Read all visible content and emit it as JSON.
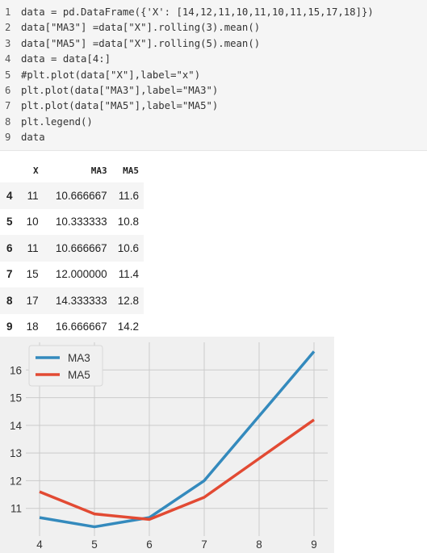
{
  "code": {
    "lines": [
      {
        "n": "1",
        "text": "data = pd.DataFrame({'X': [14,12,11,10,11,10,11,15,17,18]})"
      },
      {
        "n": "2",
        "text": "data[\"MA3\"] =data[\"X\"].rolling(3).mean()"
      },
      {
        "n": "3",
        "text": "data[\"MA5\"] =data[\"X\"].rolling(5).mean()"
      },
      {
        "n": "4",
        "text": "data = data[4:]"
      },
      {
        "n": "5",
        "text": "#plt.plot(data[\"X\"],label=\"x\")"
      },
      {
        "n": "6",
        "text": "plt.plot(data[\"MA3\"],label=\"MA3\")"
      },
      {
        "n": "7",
        "text": "plt.plot(data[\"MA5\"],label=\"MA5\")"
      },
      {
        "n": "8",
        "text": "plt.legend()"
      },
      {
        "n": "9",
        "text": "data"
      }
    ]
  },
  "table": {
    "columns": [
      "X",
      "MA3",
      "MA5"
    ],
    "rows": [
      {
        "idx": "4",
        "X": "11",
        "MA3": "10.666667",
        "MA5": "11.6"
      },
      {
        "idx": "5",
        "X": "10",
        "MA3": "10.333333",
        "MA5": "10.8"
      },
      {
        "idx": "6",
        "X": "11",
        "MA3": "10.666667",
        "MA5": "10.6"
      },
      {
        "idx": "7",
        "X": "15",
        "MA3": "12.000000",
        "MA5": "11.4"
      },
      {
        "idx": "8",
        "X": "17",
        "MA3": "14.333333",
        "MA5": "12.8"
      },
      {
        "idx": "9",
        "X": "18",
        "MA3": "16.666667",
        "MA5": "14.2"
      }
    ]
  },
  "chart_data": {
    "type": "line",
    "x": [
      4,
      5,
      6,
      7,
      8,
      9
    ],
    "series": [
      {
        "name": "MA3",
        "color": "#348abd",
        "values": [
          10.666667,
          10.333333,
          10.666667,
          12.0,
          14.333333,
          16.666667
        ]
      },
      {
        "name": "MA5",
        "color": "#e24a33",
        "values": [
          11.6,
          10.8,
          10.6,
          11.4,
          12.8,
          14.2
        ]
      }
    ],
    "xticks": [
      "4",
      "5",
      "6",
      "7",
      "8",
      "9"
    ],
    "yticks": [
      "11",
      "12",
      "13",
      "14",
      "15",
      "16"
    ],
    "xlim": [
      3.75,
      9.25
    ],
    "ylim": [
      10.0,
      17.0
    ],
    "grid": true,
    "legend": "upper-left",
    "background": "#f0f0f0",
    "gridcolor": "#cbcbcb"
  }
}
